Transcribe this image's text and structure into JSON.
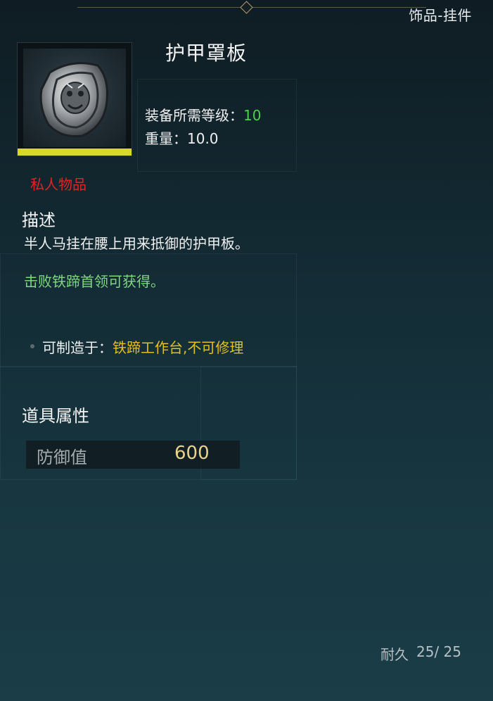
{
  "category": "饰品-挂件",
  "item": {
    "name": "护甲罩板",
    "icon": "armor-plate-icon",
    "rarity_color": "#d8d82a",
    "required_level_label": "装备所需等级：",
    "required_level_value": "10",
    "weight_label": "重量：",
    "weight_value": "10.0",
    "personal_label": "私人物品"
  },
  "description": {
    "heading": "描述",
    "text": "半人马挂在腰上用来抵御的护甲板。",
    "source": "击败铁蹄首领可获得。"
  },
  "crafting": {
    "label": "可制造于：",
    "value": "铁蹄工作台,不可修理"
  },
  "properties": {
    "heading": "道具属性",
    "stats": [
      {
        "name": "防御值",
        "value": "600"
      }
    ]
  },
  "durability": {
    "label": "耐久",
    "value": "25/ 25"
  },
  "colors": {
    "level_value": "#4bd14b",
    "personal": "#e02424",
    "source": "#7fd87f",
    "craft_value": "#e2c020",
    "stat_value": "#e8d28e"
  }
}
